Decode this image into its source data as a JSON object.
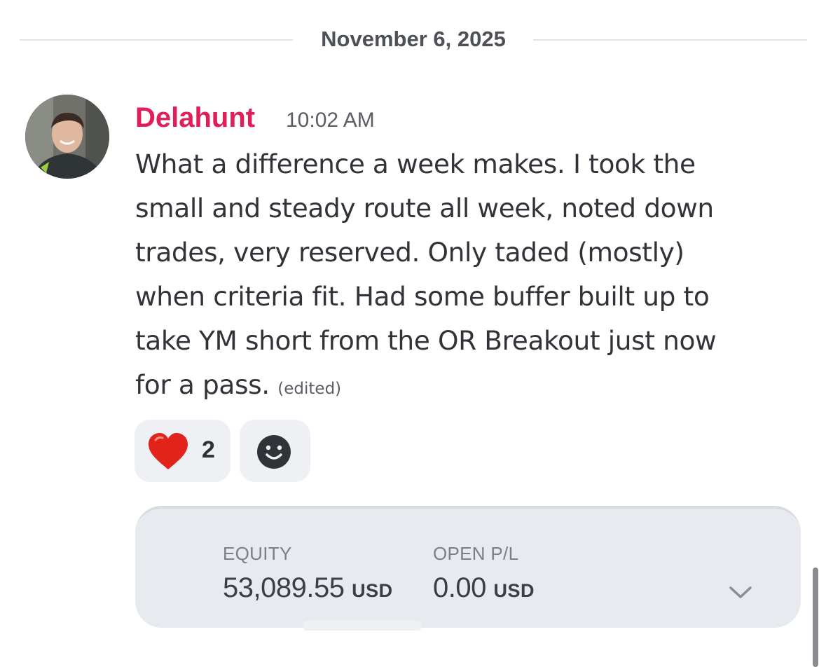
{
  "date_divider": {
    "label": "November 6, 2025"
  },
  "message": {
    "author": "Delahunt",
    "author_color": "#e01e5a",
    "timestamp": "10:02 AM",
    "lines": [
      "What a difference a week makes. I took the",
      "small and steady route all week, noted down",
      "trades, very reserved. Only taded (mostly)",
      "when criteria fit. Had some buffer built up to",
      "take YM short from the OR Breakout just now",
      "for a pass."
    ],
    "edited_label": "(edited)",
    "avatar_icon": "user-avatar-photo"
  },
  "reactions": {
    "heart": {
      "icon": "red-heart-emoji",
      "count": "2"
    },
    "add_reaction": {
      "icon": "smiley-add-reaction-icon"
    }
  },
  "embed": {
    "equity": {
      "label": "EQUITY",
      "value": "53,089.55",
      "unit": "USD"
    },
    "open_pl": {
      "label": "OPEN P/L",
      "value": "0.00",
      "unit": "USD"
    },
    "expand_icon": "chevron-down-icon"
  }
}
